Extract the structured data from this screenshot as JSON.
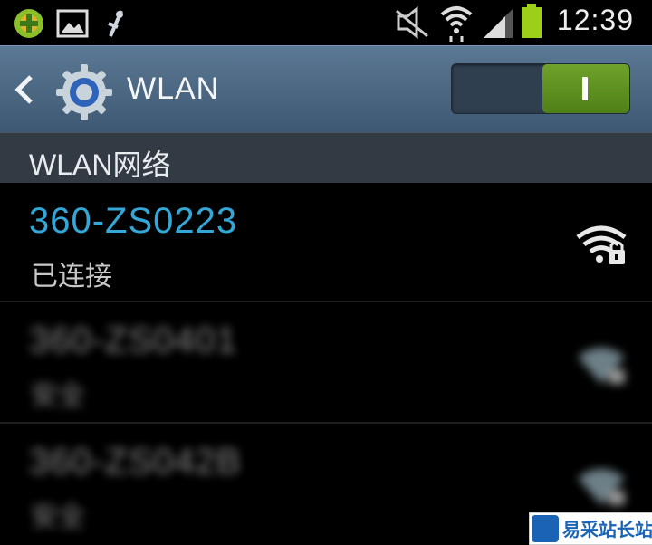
{
  "status_bar": {
    "time": "12:39",
    "left_icons": [
      "add-app-icon",
      "image-icon",
      "usb-debug-icon"
    ],
    "right_icons": [
      "mute-icon",
      "wifi-signal-icon",
      "cell-signal-icon",
      "battery-icon"
    ],
    "battery_level": 0.9,
    "accent": "#9ccf1a"
  },
  "action_bar": {
    "title": "WLAN",
    "toggle_state": "I",
    "toggle_on_color": "#5f931f"
  },
  "section": {
    "label": "WLAN网络"
  },
  "networks": [
    {
      "ssid": "360-ZS0223",
      "status": "已连接",
      "color": "#33a8d8",
      "secured": true
    },
    {
      "ssid": "360-ZS0401",
      "status": "安全",
      "color": "#cfcfcf",
      "secured": true
    },
    {
      "ssid": "360-ZS042B",
      "status": "安全",
      "color": "#cfcfcf",
      "secured": true
    }
  ],
  "watermark": {
    "text": "易采站长站"
  }
}
